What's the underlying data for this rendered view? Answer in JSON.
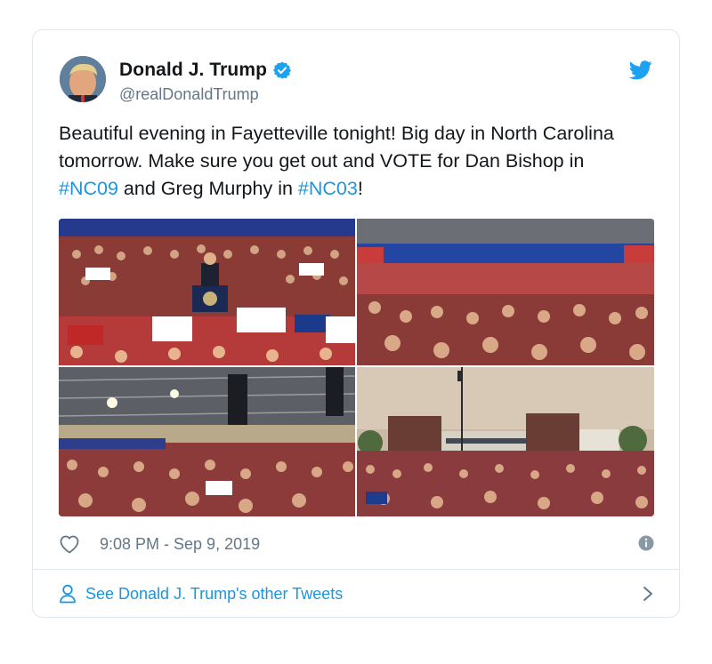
{
  "tweet": {
    "display_name": "Donald J. Trump",
    "handle": "@realDonaldTrump",
    "text_parts": {
      "p1": "Beautiful evening in Fayetteville tonight! Big day in North Carolina tomorrow. Make sure you get out and VOTE for Dan Bishop in ",
      "tag1": "#NC09",
      "p2": " and Greg Murphy in ",
      "tag2": "#NC03",
      "p3": "!"
    },
    "timestamp": "9:08 PM - Sep 9, 2019",
    "more_tweets_label": "See Donald J. Trump's other Tweets"
  },
  "icons": {
    "verified": "verified-badge-icon",
    "brand": "twitter-bird-icon",
    "like": "heart-icon",
    "info": "info-icon",
    "person": "person-icon",
    "chevron": "chevron-right-icon"
  },
  "colors": {
    "link": "#1b95e0",
    "secondary_text": "#657786",
    "border": "#e1e8ed",
    "brand_blue": "#1da1f2"
  }
}
